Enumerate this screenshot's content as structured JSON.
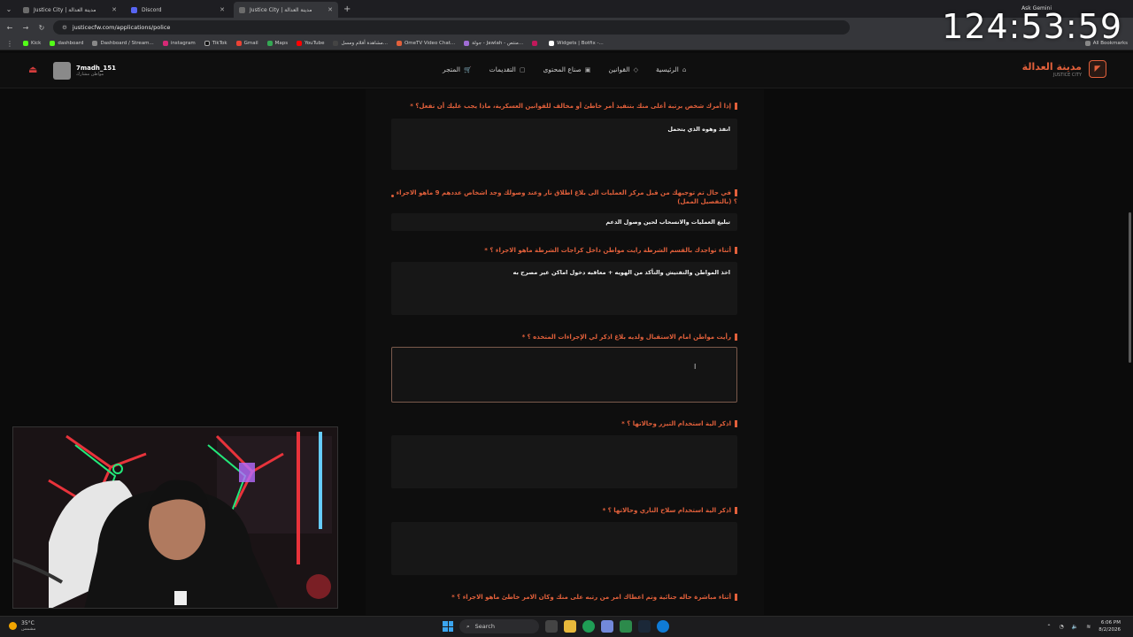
{
  "browser": {
    "tabs": [
      {
        "label": "Justice City | مدينة العدالة",
        "active": false
      },
      {
        "label": "Discord",
        "active": false
      },
      {
        "label": "Justice City | مدينة العدالة",
        "active": true
      }
    ],
    "url": "justicecfw.com/applications/police",
    "bookmarks": [
      "Kick",
      "dashboard",
      "Dashboard / Stream...",
      "instagram",
      "TikTok",
      "Gmail",
      "Maps",
      "YouTube",
      "مشاهدة أفلام ومسل...",
      "OmeTV Video Chat...",
      "جولة - Jawlah - منتص...",
      "",
      "Widgets | Botfix -..."
    ],
    "all_bookmarks": "All Bookmarks",
    "ask_gemini": "Ask Gemini"
  },
  "overlay": {
    "timer": "124:53:59"
  },
  "site": {
    "user": {
      "name": "7madh_151",
      "sub": "مواطن مشارك"
    },
    "menu": [
      "الرئيسية",
      "القوانين",
      "صناع المحتوى",
      "التقديمات",
      "المتجر"
    ],
    "brand": {
      "title": "مدينة العدالة",
      "sub": "JUSTICE CITY"
    }
  },
  "form": {
    "questions": [
      {
        "q": "إذا أمرك شخص برتبة أعلى منك بتنفيذ أمر خاطئ أو مخالف للقوانين العسكرية، ماذا يجب عليك أن تفعل؟ *",
        "a": "انفذ وهوه الذي يتحمل"
      },
      {
        "q": "في حال تم توجيهك من قبل مركز العمليات الى بلاغ اطلاق نار وعند وصولك وجد اشخاص عددهم 9 ماهو الاجراء ؟ (بالتفصيل الممل)",
        "a": "تبليغ العمليات والانسحاب لحين وصول الدعم"
      },
      {
        "q": "أثناء تواجدك بالقسم الشرطة رايت مواطن داخل كراجات الشرطة ماهو الاجراء ؟ *",
        "a": "اخذ المواطن والتفتيش والتأكد من الهويه + معاقبه دخول اماكن غير مصرح به"
      },
      {
        "q": "رأيت مواطن امام الاستقبال ولديه بلاغ اذكر لي الإجراءات المتخذه ؟ *",
        "a": ""
      },
      {
        "q": "اذكر الية استخدام التيزر وحالاتها ؟ *",
        "a": ""
      },
      {
        "q": "اذكر الية استخدام سلاح الناري وحالاتها ؟ *",
        "a": ""
      },
      {
        "q": "أثناء مباشرة حاله جنائية وتم اعطاك امر من رتبه على منك وكان الامر خاطئ ماهو الاجراء ؟ *",
        "a": ""
      }
    ]
  },
  "taskbar": {
    "weather_temp": "35°C",
    "weather_desc": "مشمس",
    "search": "Search",
    "time": "6:06 PM",
    "date": "8/2/2026"
  }
}
